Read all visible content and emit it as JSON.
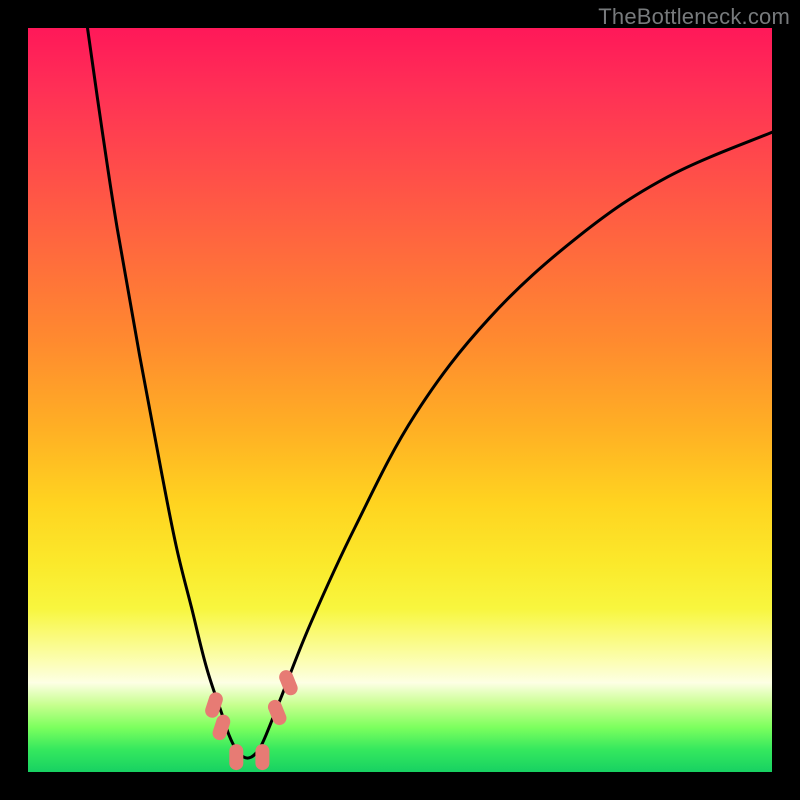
{
  "watermark": "TheBottleneck.com",
  "chart_data": {
    "type": "line",
    "title": "",
    "xlabel": "",
    "ylabel": "",
    "xlim": [
      0,
      100
    ],
    "ylim": [
      0,
      100
    ],
    "series": [
      {
        "name": "bottleneck-curve",
        "x": [
          8,
          10,
          12,
          15,
          18,
          20,
          22,
          24,
          26,
          27,
          28,
          29,
          30,
          31,
          32,
          34,
          38,
          44,
          52,
          62,
          74,
          86,
          100
        ],
        "values": [
          100,
          86,
          73,
          56,
          40,
          30,
          22,
          14,
          8,
          5,
          3,
          2,
          2,
          3,
          5,
          10,
          20,
          33,
          48,
          61,
          72,
          80,
          86
        ]
      }
    ],
    "markers": [
      {
        "name": "left-steep-1",
        "x": 25.0,
        "y": 9.0
      },
      {
        "name": "left-steep-2",
        "x": 26.0,
        "y": 6.0
      },
      {
        "name": "trough-left",
        "x": 28.0,
        "y": 2.0
      },
      {
        "name": "trough-right",
        "x": 31.5,
        "y": 2.0
      },
      {
        "name": "right-rise-1",
        "x": 33.5,
        "y": 8.0
      },
      {
        "name": "right-rise-2",
        "x": 35.0,
        "y": 12.0
      }
    ],
    "marker_color": "#e77b74",
    "curve_color": "#000000"
  }
}
